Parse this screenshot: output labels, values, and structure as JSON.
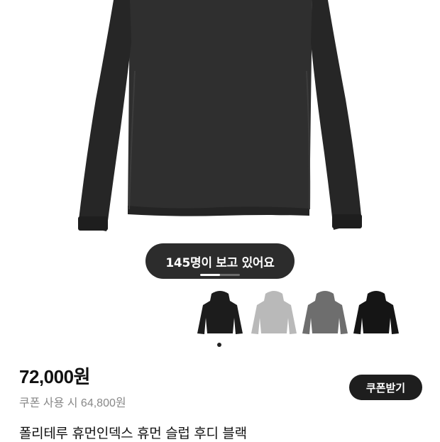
{
  "hero": {
    "viewer_count_text": "145명이 보고 있어요",
    "slide_progress": 0.5
  },
  "variants": [
    {
      "name": "black",
      "color": "#1c1c1c",
      "selected": true
    },
    {
      "name": "light-gray",
      "color": "#b9b9b9",
      "selected": false
    },
    {
      "name": "charcoal",
      "color": "#6e6e6e",
      "selected": false
    },
    {
      "name": "black",
      "color": "#151515",
      "selected": false
    }
  ],
  "pricing": {
    "price": "72,000원",
    "coupon_price": "쿠폰 사용 시 64,800원",
    "coupon_button": "쿠폰받기"
  },
  "product": {
    "name": "폴리테루 휴먼인덱스 휴먼 슬럽 후디 블랙"
  }
}
